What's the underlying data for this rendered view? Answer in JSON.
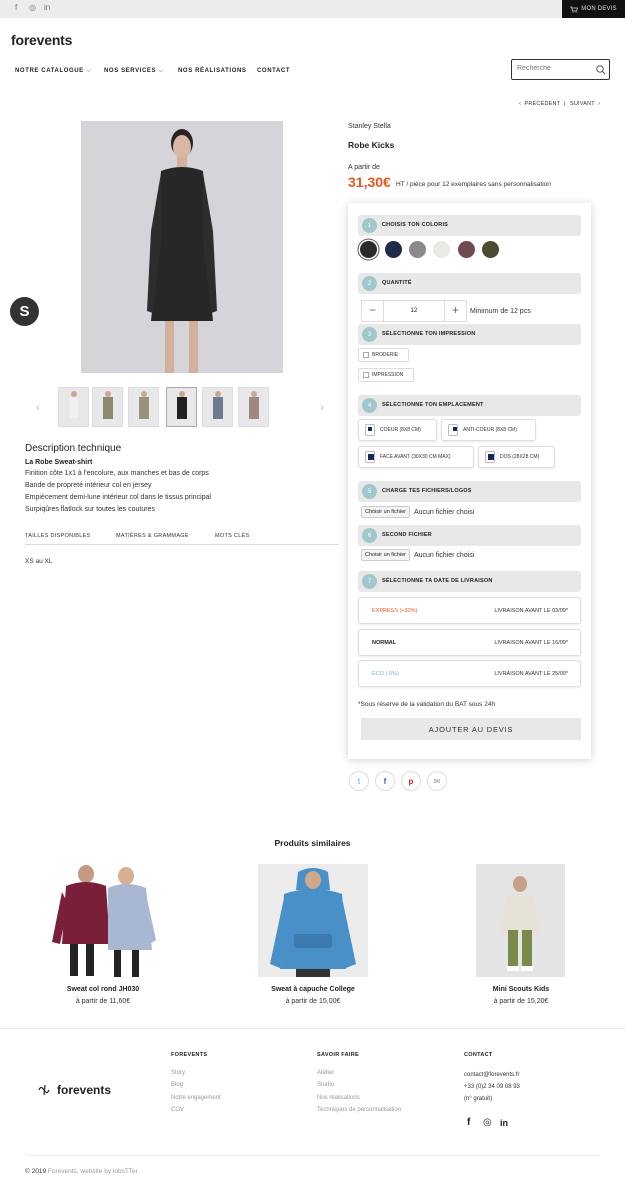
{
  "topbar": {
    "social": [
      "f",
      "◎",
      "in"
    ],
    "devis_label": "MON DEVIS"
  },
  "header": {
    "logo": "forevents",
    "nav": [
      "NOTRE CATALOGUE",
      "NOS SERVICES",
      "NOS RÉALISATIONS",
      "CONTACT"
    ],
    "search_placeholder": "Recherche"
  },
  "pager": {
    "prev": "PRÉCÉDENT",
    "sep": "|",
    "next": "SUIVANT"
  },
  "product": {
    "brand": "Stanley Stella",
    "name": "Robe Kicks",
    "from_label": "A partir de",
    "price": "31,30€",
    "price_note": "HT / pièce pour 12 exemplaires sans personnalisation"
  },
  "description": {
    "title": "Description technique",
    "subtitle": "La Robe Sweat-shirt",
    "lines": [
      "Finition côte 1x1 à l'encolure, aux manches et  bas de corps",
      "Bande de propreté intérieur col en jersey",
      "Empiècement demi-lune intérieur col dans le tissus principal",
      "Surpiqûres flatlock sur toutes les coutures"
    ],
    "tabs": [
      "TAILLES DISPONIBLES",
      "MATIÈRES & GRAMMAGE",
      "MOTS CLÉS"
    ],
    "sizes": "XS au XL"
  },
  "config": {
    "steps": [
      {
        "num": "1",
        "label": "CHOISIS TON COLORIS"
      },
      {
        "num": "2",
        "label": "QUANTITÉ"
      },
      {
        "num": "3",
        "label": "SÉLECTIONNE TON IMPRESSION"
      },
      {
        "num": "4",
        "label": "SÉLECTIONNE TON EMPLACEMENT"
      },
      {
        "num": "5",
        "label": "CHARGE TES FICHIERS/LOGOS"
      },
      {
        "num": "6",
        "label": "SECOND FICHIER"
      },
      {
        "num": "7",
        "label": "SÉLECTIONNE TA DATE DE LIVRAISON"
      }
    ],
    "colors": [
      "#2b2b2b",
      "#1f2a4a",
      "#8a8a8a",
      "#ece9e2",
      "#6e4a52",
      "#4e4a30"
    ],
    "quantity": {
      "value": "12",
      "minus": "−",
      "plus": "+",
      "note": "Minimum de 12 pcs"
    },
    "impression": [
      "BRODERIE",
      "IMPRESSION"
    ],
    "placements": [
      "COEUR (8X8 CM)",
      "ANTI-COEUR (8X8 CM)",
      "FACE AVANT (30X30 CM MAX)",
      "DOS (28X28 CM)"
    ],
    "file_button": "Choisir un fichier",
    "file_status": "Aucun fichier choisi",
    "delivery": [
      {
        "name": "EXPRESS (+30%)",
        "date": "LIVRAISON AVANT LE 03/09*",
        "color": "#e8571f"
      },
      {
        "name": "NORMAL",
        "date": "LIVRAISON AVANT LE 16/09*",
        "color": "#222222"
      },
      {
        "name": "ECO (-5%)",
        "date": "LIVRAISON AVANT LE 25/09*",
        "color": "#7ab0c8"
      }
    ],
    "note": "*Sous réserve de la validation du BAT sous 24h",
    "add_button": "AJOUTER AU DEVIS"
  },
  "share": [
    "twitter-icon",
    "facebook-icon",
    "pinterest-icon",
    "mail-icon"
  ],
  "similar": {
    "title": "Produits similaires",
    "items": [
      {
        "name": "Sweat col rond JH030",
        "price": "à partir de 11,60€"
      },
      {
        "name": "Sweat à capuche College",
        "price": "à partir de 15,00€"
      },
      {
        "name": "Mini Scouts Kids",
        "price": "à partir de 15,20€"
      }
    ]
  },
  "footer": {
    "logo": "forevents",
    "columns": [
      {
        "title": "FOREVENTS",
        "links": [
          "Story",
          "Blog",
          "Notre engagement",
          "CGV"
        ]
      },
      {
        "title": "SAVOIR FAIRE",
        "links": [
          "Atelier",
          "Studio",
          "Nos réalisations",
          "Techniques de personnalisation"
        ]
      },
      {
        "title": "CONTACT",
        "links": [
          "contact@forevents.fr",
          "+33 (0)2 34 09 08 93",
          "(n° gratuit)"
        ]
      }
    ],
    "social": [
      "f",
      "◎",
      "in"
    ],
    "copyright": "© 2019",
    "credit": "Forevents, website by lobsTTer"
  }
}
